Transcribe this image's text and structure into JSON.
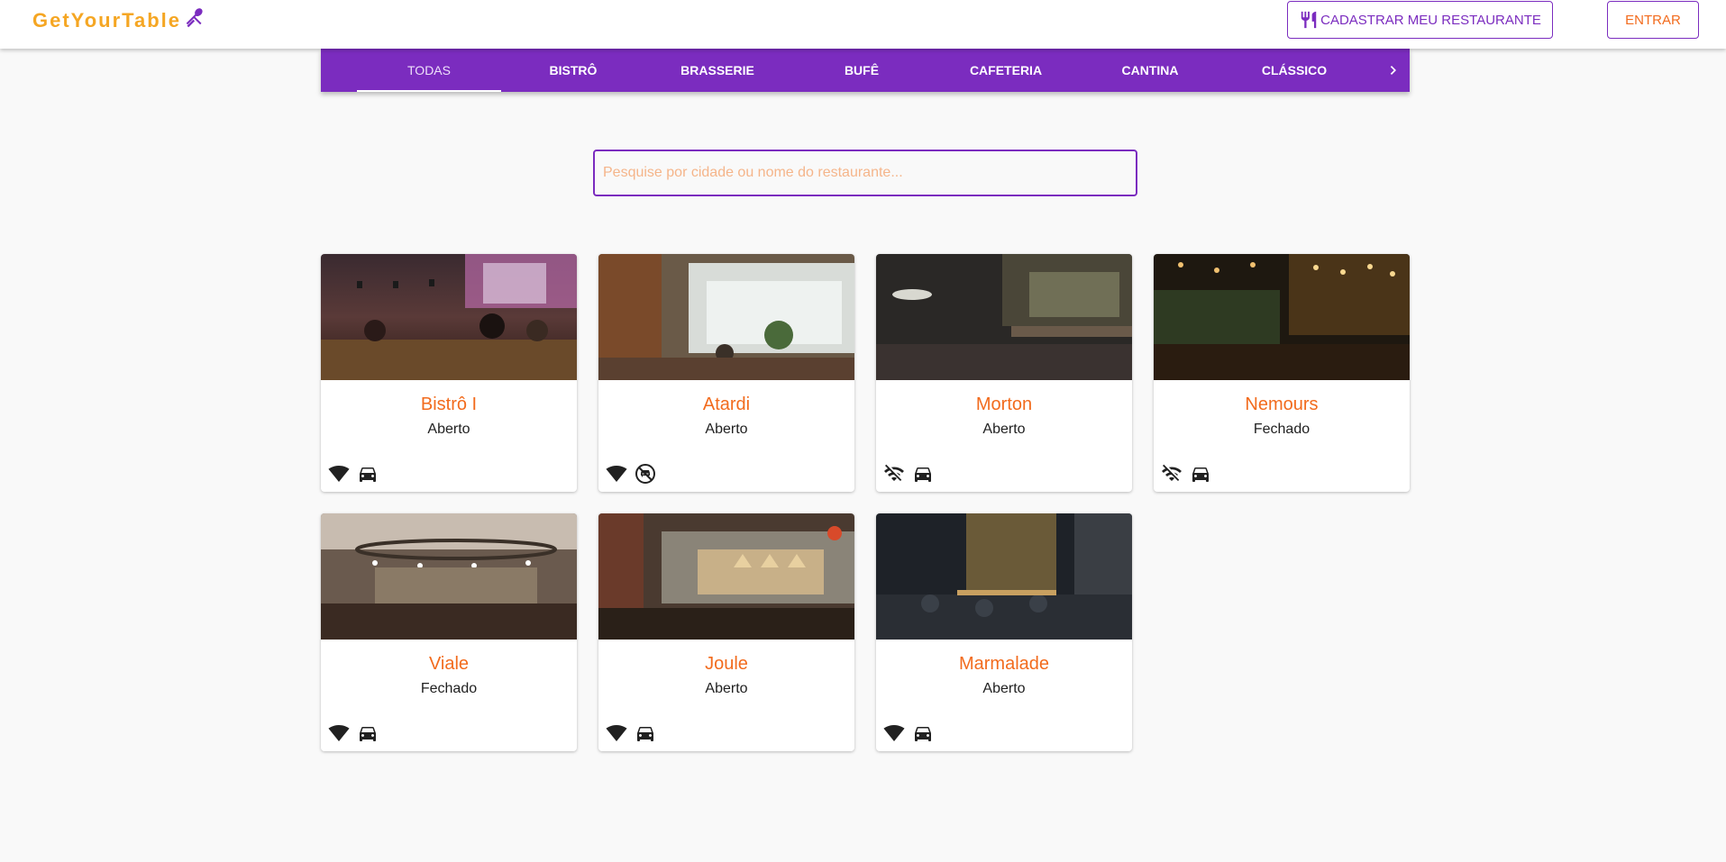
{
  "brand": {
    "name": "GetYourTable",
    "icon": "fork-knife-cross-icon",
    "color": "#f5a623"
  },
  "header": {
    "register_button": {
      "label": "CADASTRAR MEU RESTAURANTE",
      "icon": "restaurant-icon"
    },
    "login_button": {
      "label": "ENTRAR"
    }
  },
  "categories": {
    "active": "TODAS",
    "items": [
      "TODAS",
      "BISTRÔ",
      "BRASSERIE",
      "BUFÊ",
      "CAFETERIA",
      "CANTINA",
      "CLÁSSICO"
    ],
    "next_icon": "chevron-right-icon"
  },
  "search": {
    "placeholder": "Pesquise por cidade ou nome do restaurante...",
    "value": ""
  },
  "colors": {
    "primary": "#7b2cbf",
    "accent": "#f26b1d",
    "background": "#f9f9f9"
  },
  "restaurants": [
    {
      "name": "Bistrô I",
      "status": "Aberto",
      "amenities": [
        "wifi-icon",
        "car-icon"
      ]
    },
    {
      "name": "Atardi",
      "status": "Aberto",
      "amenities": [
        "wifi-icon",
        "no-parking-icon"
      ]
    },
    {
      "name": "Morton",
      "status": "Aberto",
      "amenities": [
        "wifi-off-icon",
        "car-icon"
      ]
    },
    {
      "name": "Nemours",
      "status": "Fechado",
      "amenities": [
        "wifi-off-icon",
        "car-icon"
      ]
    },
    {
      "name": "Viale",
      "status": "Fechado",
      "amenities": [
        "wifi-icon",
        "car-icon"
      ]
    },
    {
      "name": "Joule",
      "status": "Aberto",
      "amenities": [
        "wifi-icon",
        "car-icon"
      ]
    },
    {
      "name": "Marmalade",
      "status": "Aberto",
      "amenities": [
        "wifi-icon",
        "car-icon"
      ]
    }
  ]
}
